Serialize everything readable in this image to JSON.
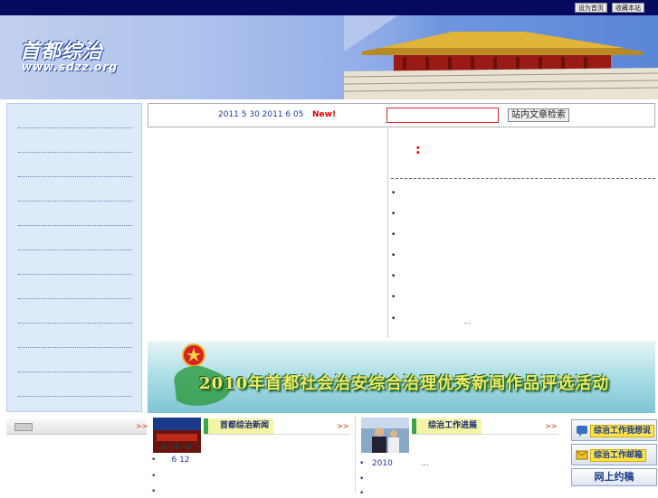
{
  "topbar": {
    "set_homepage": "设为首页",
    "bookmark": "收藏本站"
  },
  "header": {
    "logo_text": "首都综治",
    "logo_url": "www.sdzz.org"
  },
  "search": {
    "date_range": "2011 5 30  2011 6 05",
    "new_badge": "New!",
    "input_value": "",
    "button_label": "站内文章检索"
  },
  "news": {
    "red_mark": ":",
    "items": [
      "",
      "",
      "",
      "",
      "",
      "",
      ""
    ],
    "last_item_suffix": "..."
  },
  "campaign": {
    "title": "2010年首都社会治安综合治理优秀新闻作品评选活动"
  },
  "lower_left": {
    "more": ">>"
  },
  "section1": {
    "title": "首都综治新闻",
    "more": ">>",
    "items": [
      "6 12",
      "",
      ""
    ]
  },
  "section2": {
    "title": "综治工作进展",
    "more": ">>",
    "items": [
      "2010",
      "",
      ""
    ],
    "item1_suffix": "..."
  },
  "right_buttons": {
    "btn1": "综治工作我想说",
    "btn2": "综治工作邮箱",
    "btn3": "网上约稿"
  },
  "colors": {
    "topbar": "#050a5f",
    "accent_red": "#e00000",
    "link_blue": "#1a3aa0",
    "panel_blue": "#ddeafa"
  }
}
